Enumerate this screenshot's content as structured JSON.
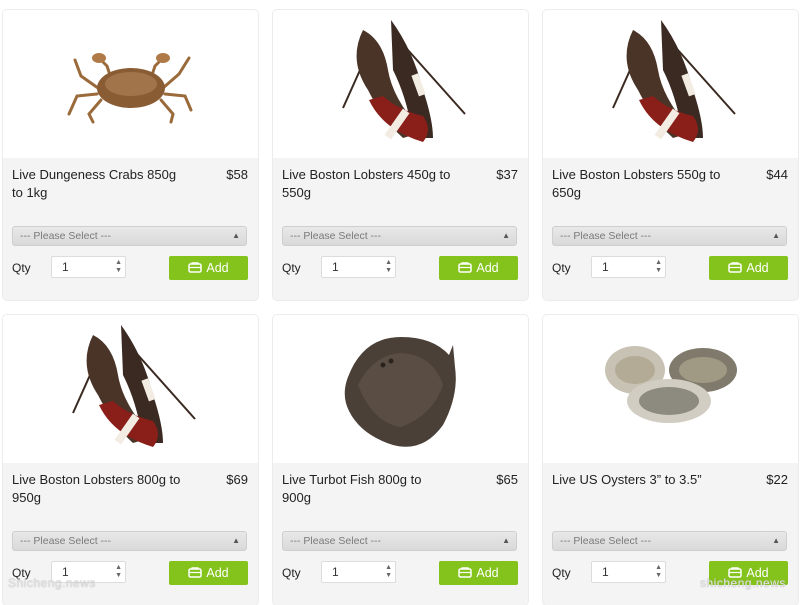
{
  "products": [
    {
      "name": "Live Dungeness Crabs 850g to 1kg",
      "price": "$58",
      "select_placeholder": "--- Please Select ---",
      "qty_label": "Qty",
      "qty_value": "1",
      "add_label": "Add",
      "image_icon": "crab-icon"
    },
    {
      "name": "Live Boston Lobsters 450g to 550g",
      "price": "$37",
      "select_placeholder": "--- Please Select ---",
      "qty_label": "Qty",
      "qty_value": "1",
      "add_label": "Add",
      "image_icon": "lobster-icon"
    },
    {
      "name": "Live Boston Lobsters 550g to 650g",
      "price": "$44",
      "select_placeholder": "--- Please Select ---",
      "qty_label": "Qty",
      "qty_value": "1",
      "add_label": "Add",
      "image_icon": "lobster-icon"
    },
    {
      "name": "Live Boston Lobsters 800g to 950g",
      "price": "$69",
      "select_placeholder": "--- Please Select ---",
      "qty_label": "Qty",
      "qty_value": "1",
      "add_label": "Add",
      "image_icon": "lobster-icon"
    },
    {
      "name": "Live Turbot Fish 800g to 900g",
      "price": "$65",
      "select_placeholder": "--- Please Select ---",
      "qty_label": "Qty",
      "qty_value": "1",
      "add_label": "Add",
      "image_icon": "turbot-fish-icon"
    },
    {
      "name": "Live US Oysters 3” to 3.5”",
      "price": "$22",
      "select_placeholder": "--- Please Select ---",
      "qty_label": "Qty",
      "qty_value": "1",
      "add_label": "Add",
      "image_icon": "oysters-icon"
    }
  ],
  "watermark": {
    "left": "Shicheng.news",
    "right": "shicheng.news"
  },
  "colors": {
    "add_button": "#84c21c",
    "card_bg": "#f4f4f4",
    "select_bg": "#dddddd"
  }
}
